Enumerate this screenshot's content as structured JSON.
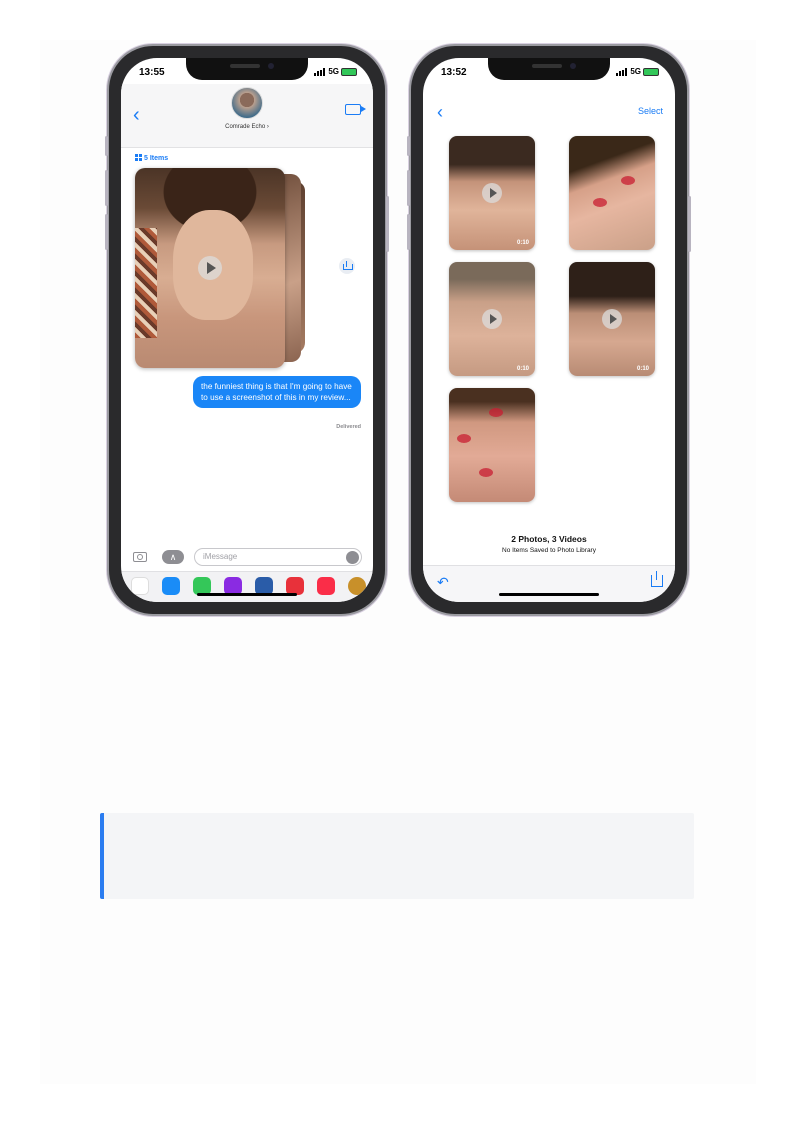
{
  "left_phone": {
    "status": {
      "time": "13:55",
      "network": "5G"
    },
    "header": {
      "contact_name": "Comrade Echo"
    },
    "attachment": {
      "items_label": "5 Items"
    },
    "message": {
      "text": "the funniest thing is that I'm going to have to use a screenshot of this in my review...",
      "status": "Delivered"
    },
    "composer": {
      "placeholder": "iMessage"
    },
    "app_strip": [
      {
        "icon": "photos-app-icon",
        "color": "#ffffff"
      },
      {
        "icon": "app-store-icon",
        "color": "#1a8cf7"
      },
      {
        "icon": "green-app-icon",
        "color": "#34c759"
      },
      {
        "icon": "purple-app-icon",
        "color": "#8a2be2"
      },
      {
        "icon": "blue-app-icon",
        "color": "#2a5ca8"
      },
      {
        "icon": "red-app-icon",
        "color": "#e8313a"
      },
      {
        "icon": "music-app-icon",
        "color": "#fa2d48"
      },
      {
        "icon": "avatar-app-icon",
        "color": "#c8902a"
      }
    ]
  },
  "right_phone": {
    "status": {
      "time": "13:52",
      "network": "5G"
    },
    "select_label": "Select",
    "thumbnails": [
      {
        "type": "video",
        "duration": "0:10"
      },
      {
        "type": "photo"
      },
      {
        "type": "video",
        "duration": "0:10"
      },
      {
        "type": "video",
        "duration": "0:10"
      },
      {
        "type": "photo"
      }
    ],
    "summary": {
      "title": "2 Photos, 3 Videos",
      "subtitle": "No Items Saved to Photo Library"
    }
  },
  "colors": {
    "accent": "#1a7cf5",
    "bubble": "#1a86f7",
    "callout_border": "#2a7cf0"
  }
}
